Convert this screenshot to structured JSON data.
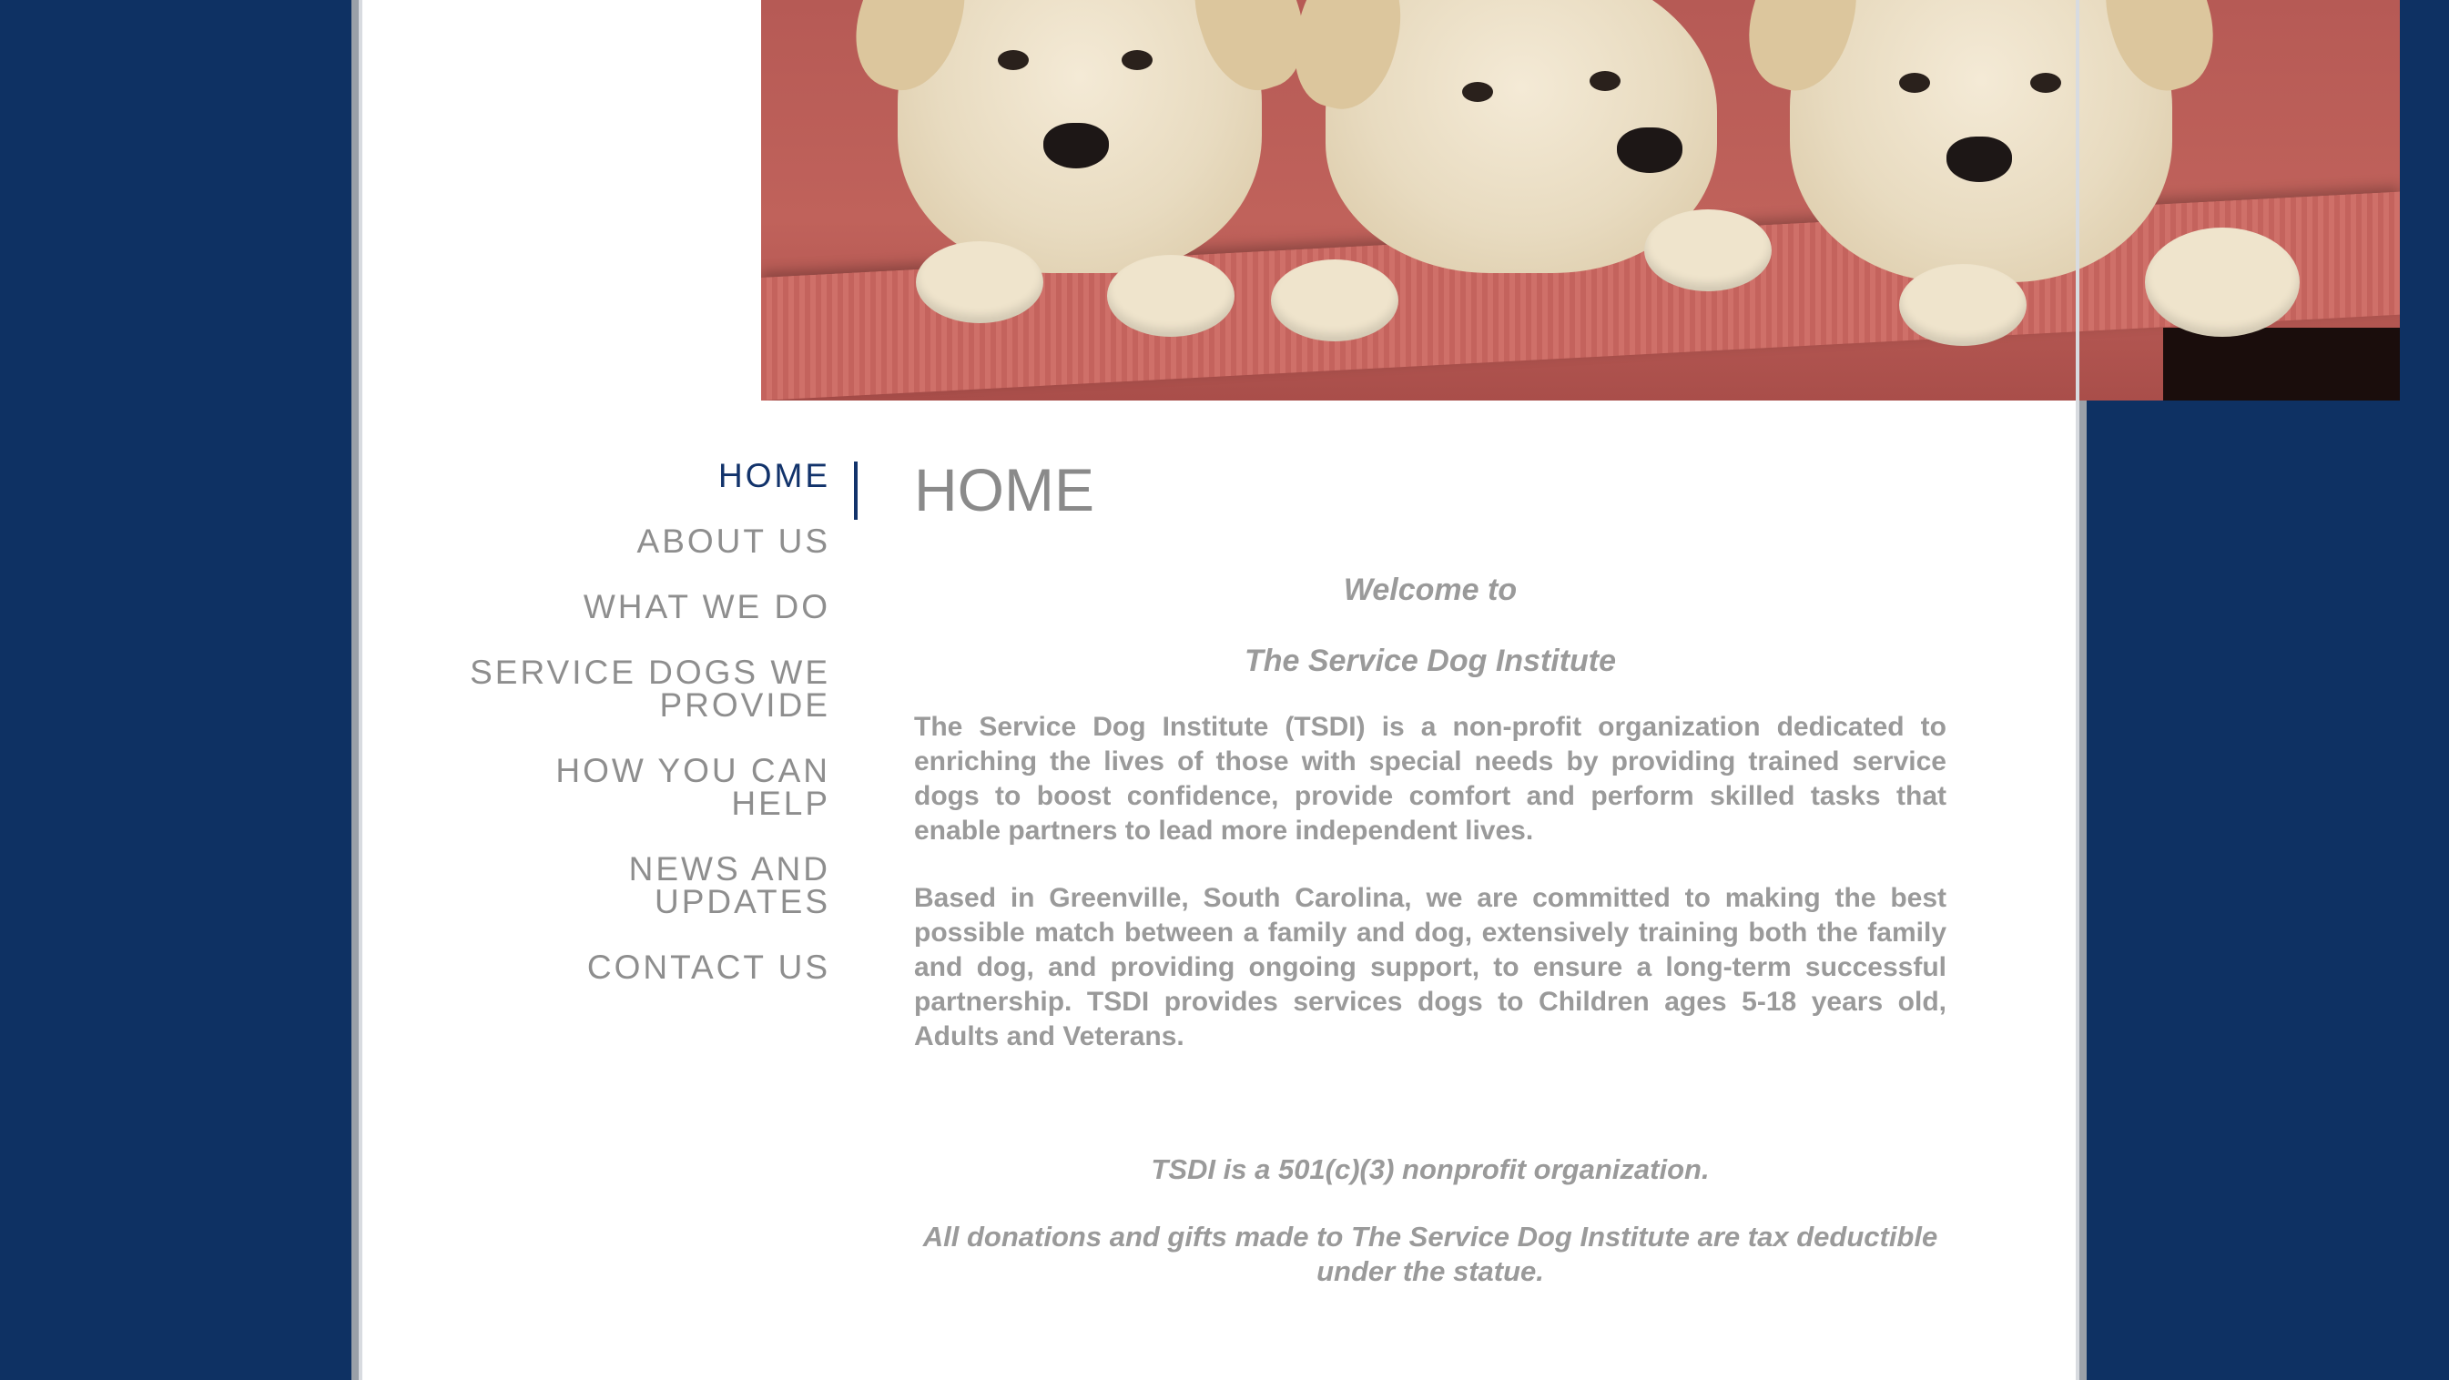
{
  "header": {
    "image_alt": "three yellow labrador puppies on a red dog bed"
  },
  "nav": {
    "items": [
      {
        "label": "HOME",
        "active": true
      },
      {
        "label": "ABOUT US",
        "active": false
      },
      {
        "label": "WHAT WE DO",
        "active": false
      },
      {
        "label": "SERVICE DOGS WE PROVIDE",
        "active": false
      },
      {
        "label": "HOW YOU CAN HELP",
        "active": false
      },
      {
        "label": "NEWS AND UPDATES",
        "active": false
      },
      {
        "label": "CONTACT US",
        "active": false
      }
    ]
  },
  "main": {
    "title": "HOME",
    "welcome_line1": "Welcome to",
    "welcome_line2": "The Service Dog Institute",
    "paragraph1": "The Service Dog Institute (TSDI) is a non-profit organization dedicated to enriching the lives of those with special needs by providing trained service dogs to boost confidence, provide comfort and perform skilled tasks that enable partners to lead more independent lives.",
    "paragraph2": "Based in Greenville, South Carolina, we are committed to making the best possible match between a family and dog, extensively training both the family and dog, and providing ongoing support, to ensure a long-term successful partnership.  TSDI provides services dogs to Children  ages 5-18 years old, Adults and Veterans.",
    "nonprofit_line": "TSDI is a 501(c)(3) nonprofit organization.",
    "donation_line": "All donations and gifts made to The Service Dog Institute are tax deductible under the statue."
  },
  "colors": {
    "background": "#0e3163",
    "nav_active": "#12336b",
    "text_gray": "#9a9a9a"
  }
}
